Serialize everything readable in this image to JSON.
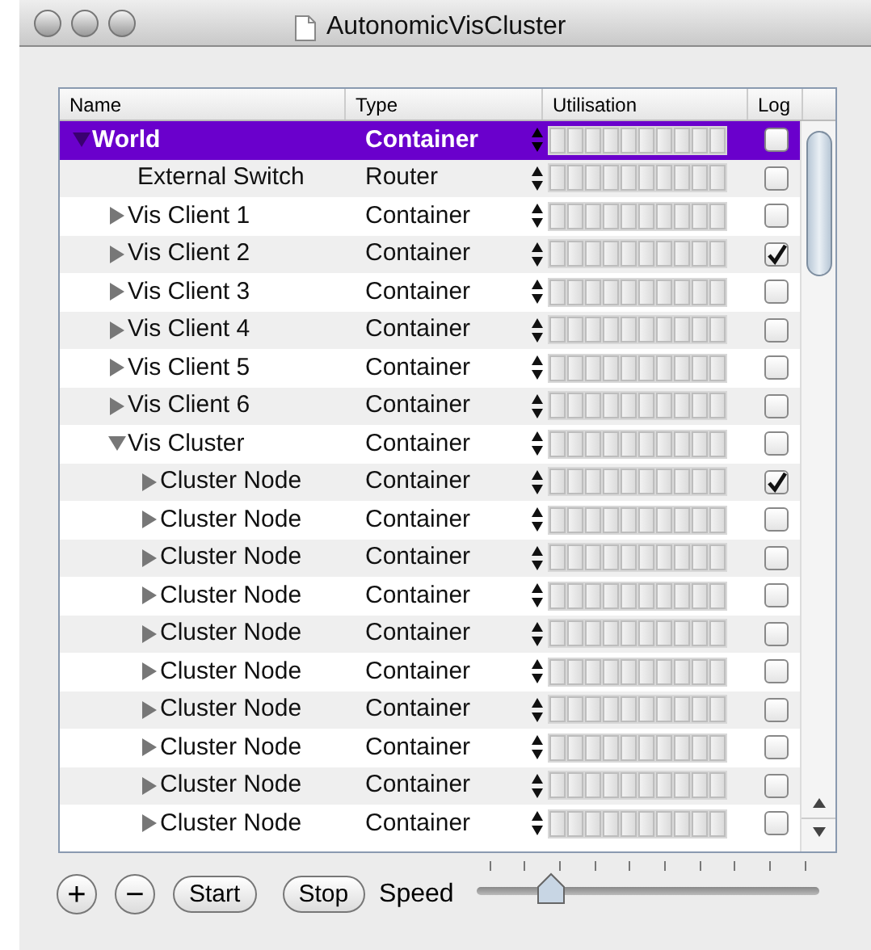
{
  "window": {
    "title": "AutonomicVisCluster"
  },
  "table": {
    "columns": [
      "Name",
      "Type",
      "Utilisation",
      "Log"
    ],
    "rows": [
      {
        "name": "World",
        "type": "Container",
        "level": 0,
        "log": false,
        "selected": true,
        "expanded": true,
        "children": [
          {
            "name": "External Switch",
            "type": "Router",
            "level": 0,
            "log": false,
            "selected": false
          },
          {
            "name": "Vis Client 1",
            "type": "Container",
            "level": 0,
            "log": false,
            "selected": false,
            "expanded": false
          },
          {
            "name": "Vis Client 2",
            "type": "Container",
            "level": 0,
            "log": true,
            "selected": false,
            "expanded": false
          },
          {
            "name": "Vis Client 3",
            "type": "Container",
            "level": 0,
            "log": false,
            "selected": false,
            "expanded": false
          },
          {
            "name": "Vis Client 4",
            "type": "Container",
            "level": 0,
            "log": false,
            "selected": false,
            "expanded": false
          },
          {
            "name": "Vis Client 5",
            "type": "Container",
            "level": 0,
            "log": false,
            "selected": false,
            "expanded": false
          },
          {
            "name": "Vis Client 6",
            "type": "Container",
            "level": 0,
            "log": false,
            "selected": false,
            "expanded": false
          },
          {
            "name": "Vis Cluster",
            "type": "Container",
            "level": 0,
            "log": false,
            "selected": false,
            "expanded": true,
            "children": [
              {
                "name": "Cluster Node",
                "type": "Container",
                "level": 0,
                "log": true,
                "selected": false,
                "expanded": false
              },
              {
                "name": "Cluster Node",
                "type": "Container",
                "level": 0,
                "log": false,
                "selected": false,
                "expanded": false
              },
              {
                "name": "Cluster Node",
                "type": "Container",
                "level": 0,
                "log": false,
                "selected": false,
                "expanded": false
              },
              {
                "name": "Cluster Node",
                "type": "Container",
                "level": 0,
                "log": false,
                "selected": false,
                "expanded": false
              },
              {
                "name": "Cluster Node",
                "type": "Container",
                "level": 0,
                "log": false,
                "selected": false,
                "expanded": false
              },
              {
                "name": "Cluster Node",
                "type": "Container",
                "level": 0,
                "log": false,
                "selected": false,
                "expanded": false
              },
              {
                "name": "Cluster Node",
                "type": "Container",
                "level": 0,
                "log": false,
                "selected": false,
                "expanded": false
              },
              {
                "name": "Cluster Node",
                "type": "Container",
                "level": 0,
                "log": false,
                "selected": false,
                "expanded": false
              },
              {
                "name": "Cluster Node",
                "type": "Container",
                "level": 0,
                "log": false,
                "selected": false,
                "expanded": false
              },
              {
                "name": "Cluster Node",
                "type": "Container",
                "level": 0,
                "log": false,
                "selected": false,
                "expanded": false
              }
            ]
          }
        ]
      }
    ]
  },
  "controls": {
    "buttons": [
      {
        "kind": "icon",
        "label": "+"
      },
      {
        "kind": "icon",
        "label": "−"
      },
      {
        "kind": "text",
        "label": "Start"
      },
      {
        "kind": "text",
        "label": "Stop"
      }
    ],
    "speed": {
      "label": "Speed",
      "level": 0.22
    }
  }
}
